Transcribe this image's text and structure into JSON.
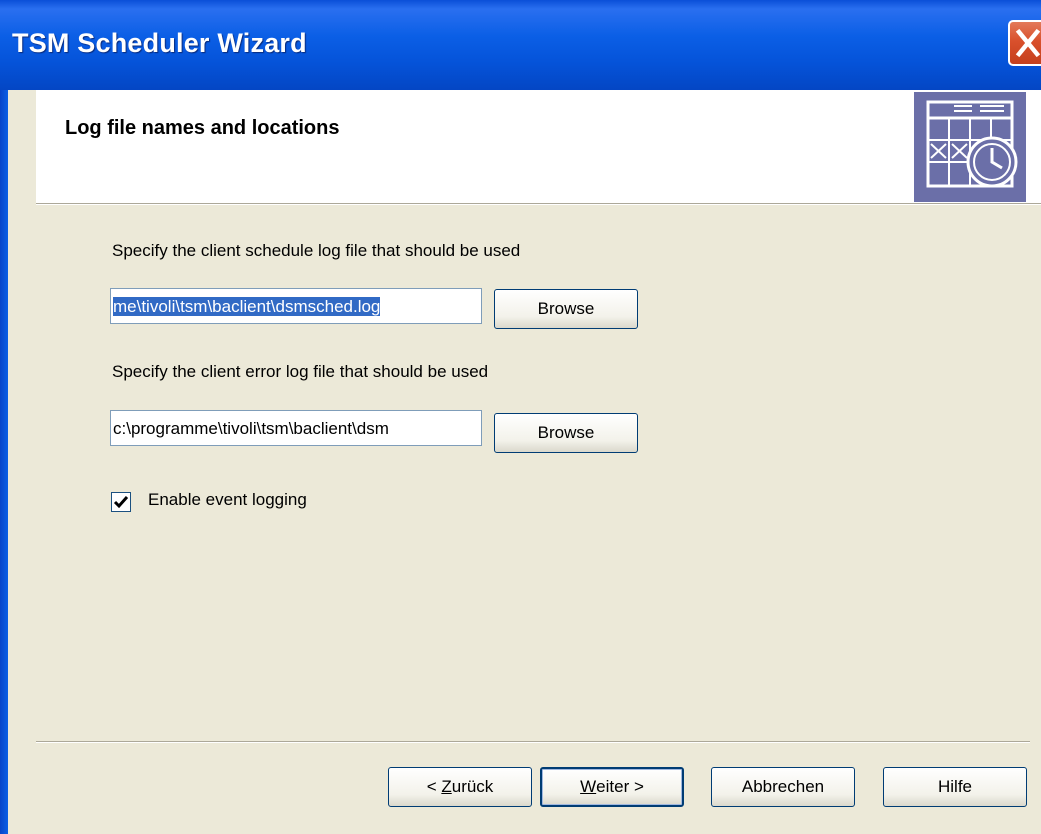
{
  "window": {
    "title": "TSM Scheduler Wizard",
    "close_symbol": "✕"
  },
  "header": {
    "title": "Log file names and locations",
    "icon": "calendar-clock-icon"
  },
  "schedule_log": {
    "label": "Specify the client schedule log file that should be used",
    "value": "me\\tivoli\\tsm\\baclient\\dsmsched.log",
    "browse_label": "Browse"
  },
  "error_log": {
    "label": "Specify the client error log file that should be used",
    "value": "c:\\programme\\tivoli\\tsm\\baclient\\dsm",
    "browse_label": "Browse"
  },
  "event_logging": {
    "label": "Enable event logging",
    "checked": true,
    "check_mark": "✔"
  },
  "footer": {
    "back_prefix": "< ",
    "back_mnemonic": "Z",
    "back_rest": "urück",
    "next_mnemonic": "W",
    "next_rest": "eiter >",
    "cancel_label": "Abbrechen",
    "help_label": "Hilfe"
  },
  "colors": {
    "titlebar": "#0b5fe6",
    "dialog_bg": "#ece9d8",
    "selection": "#316ac5",
    "icon_bg": "#6b6fa8"
  }
}
